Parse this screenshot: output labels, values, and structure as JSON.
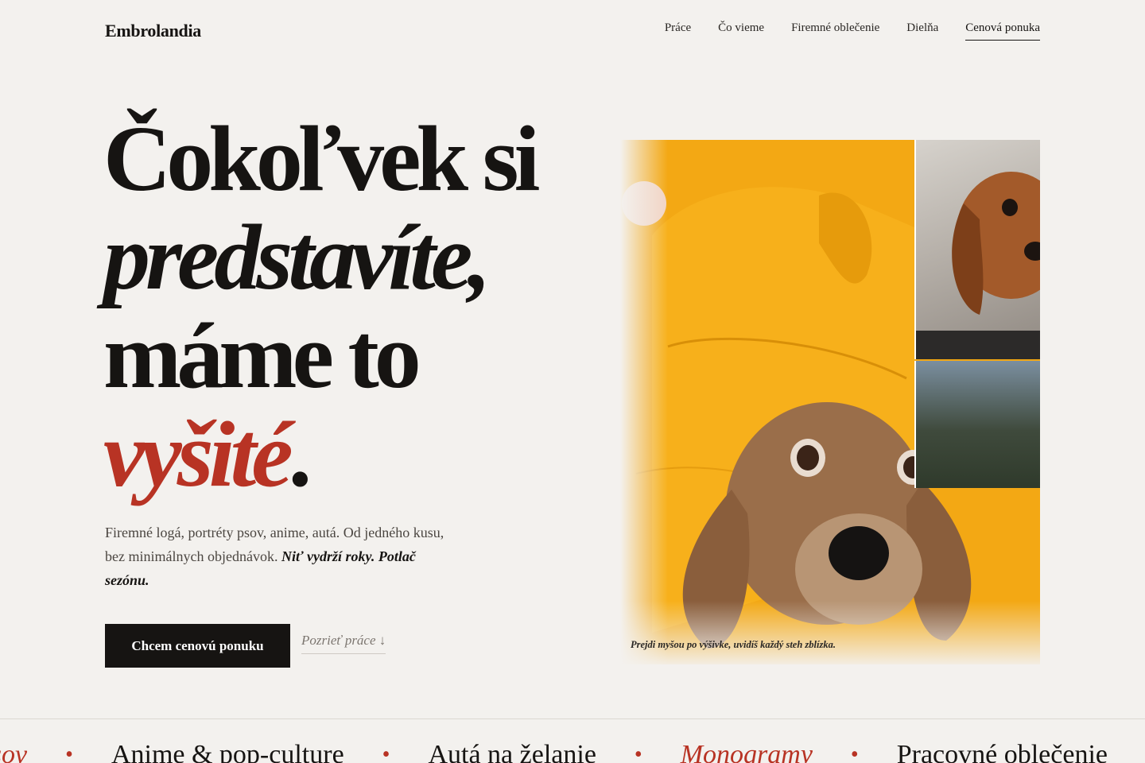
{
  "brand": "Embrolandia",
  "nav": [
    {
      "label": "Práce"
    },
    {
      "label": "Čo vieme"
    },
    {
      "label": "Firemné oblečenie"
    },
    {
      "label": "Dielňa"
    },
    {
      "label": "Cenová ponuka",
      "active": true
    }
  ],
  "hero": {
    "line1": "Čokoľvek si",
    "line2": "predstavíte,",
    "line3": "máme to",
    "line4_accent": "vyšité",
    "line4_tail": ".",
    "lead_text": "Firemné logá, portréty psov, anime, autá. Od jedného kusu, bez minimálnych objednávok. ",
    "lead_emphasis": "Niť vydrží roky. Potlač sezónu.",
    "cta_primary": "Chcem cenovú ponuku",
    "cta_secondary": "Pozrieť práce ↓"
  },
  "collage": {
    "caption": "Prejdi myšou po výšivke, uvidíš každý steh zblízka."
  },
  "marquee": [
    {
      "text": "Portréty psov",
      "italic": true
    },
    {
      "text": "Anime & pop-culture",
      "italic": false
    },
    {
      "text": "Autá na želanie",
      "italic": false
    },
    {
      "text": "Monogramy",
      "italic": true
    },
    {
      "text": "Pracovné oblečenie",
      "italic": false
    }
  ],
  "marquee_separator": "•",
  "colors": {
    "background": "#f3f1ee",
    "ink": "#161412",
    "accent": "#b83324",
    "hoodie": "#f3a814"
  }
}
